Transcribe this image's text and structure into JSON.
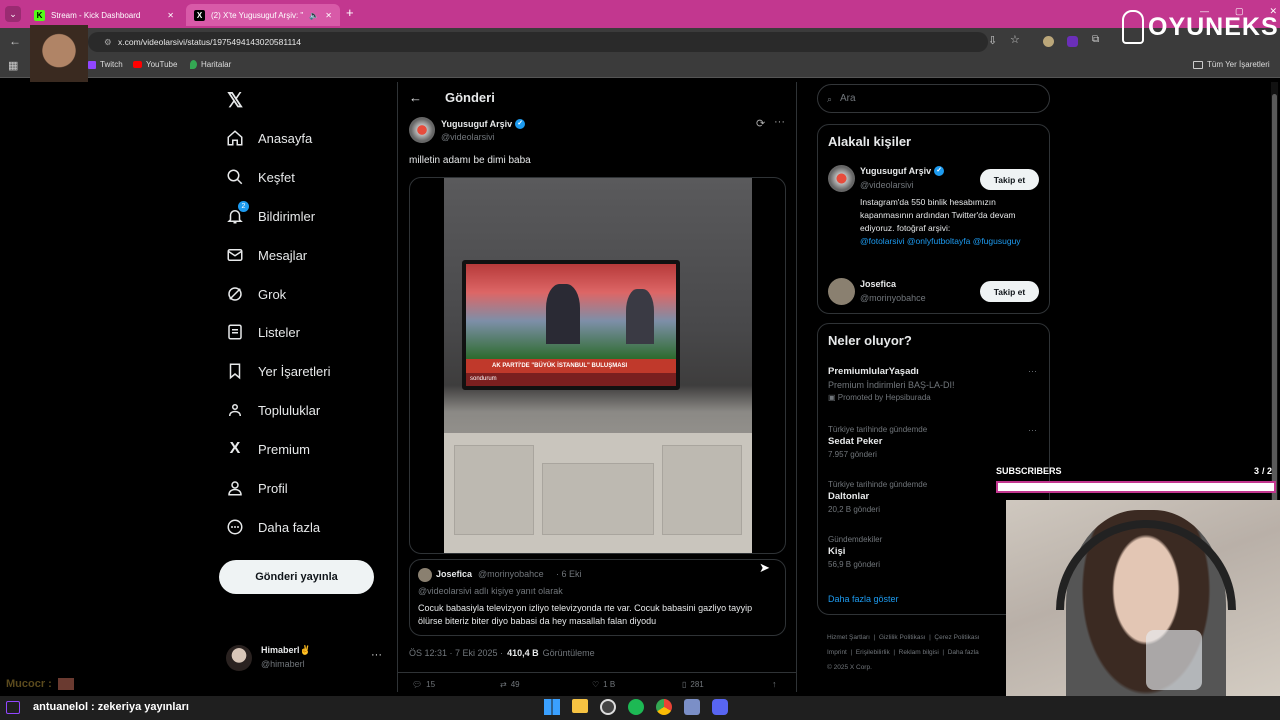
{
  "browser": {
    "tabs": [
      {
        "title": "Stream - Kick Dashboard"
      },
      {
        "title": "(2) X'te Yugusuguf Arşiv: \"m"
      }
    ],
    "url": "x.com/videolarsivi/status/1975494143020581114",
    "bookmarks": [
      "Twitch",
      "YouTube",
      "Haritalar"
    ],
    "bookmarks_right": "Tüm Yer İşaretleri",
    "brand_overlay": "OYUNEKS"
  },
  "nav": {
    "items": [
      "Anasayfa",
      "Keşfet",
      "Bildirimler",
      "Mesajlar",
      "Grok",
      "Listeler",
      "Yer İşaretleri",
      "Topluluklar",
      "Premium",
      "Profil",
      "Daha fazla"
    ],
    "notif_badge": "2",
    "post_button": "Gönderi yayınla",
    "account_name": "Himaberl✌",
    "account_handle": "@himaberl"
  },
  "post": {
    "header_title": "Gönderi",
    "author_name": "Yugusuguf Arşiv",
    "author_handle": "@videolarsivi",
    "text": "milletin adamı be dimi baba",
    "tv_caption": "AK PARTİ'DE \"BÜYÜK İSTANBUL\" BULUŞMASI",
    "tv_ticker": "sondurum",
    "quote_author": "Josefica",
    "quote_handle": "@morinyobahce",
    "quote_date": "· 6 Eki",
    "quote_reply_to": "@videolarsivi adlı kişiye yanıt olarak",
    "quote_text": "Cocuk babasiyla televizyon izliyo televizyonda rte var. Cocuk babasini gazliyo tayyip ölürse biteriz biter diyo babasi da hey masallah falan diyodu",
    "timestamp": "ÖS 12:31 · 7 Eki 2025 ·",
    "views_count": "410,4 B",
    "views_label": "Görüntüleme",
    "stats": [
      "15",
      "49",
      "1 B",
      "281"
    ]
  },
  "right": {
    "search_placeholder": "Ara",
    "relevant_title": "Alakalı kişiler",
    "people": [
      {
        "name": "Yugusuguf Arşiv",
        "handle": "@videolarsivi",
        "follow": "Takip et",
        "bio": "Instagram'da 550 binlik hesabımızın kapanmasının ardından Twitter'da devam ediyoruz. fotoğraf arşivi:",
        "bio_links": "@fotolarsivi @onlyfutboltayfa @fugusuguy"
      },
      {
        "name": "Josefica",
        "handle": "@morinyobahce",
        "follow": "Takip et"
      }
    ],
    "trends_title": "Neler oluyor?",
    "trends": [
      {
        "title": "PremiumlularYaşadı",
        "subtitle": "Premium İndirimleri BAŞ-LA-DI!",
        "meta": "Promoted by Hepsiburada"
      },
      {
        "context": "Türkiye tarihinde gündemde",
        "title": "Sedat Peker",
        "meta": "7.957 gönderi"
      },
      {
        "context": "Türkiye tarihinde gündemde",
        "title": "Daltonlar",
        "meta": "20,2 B gönderi"
      },
      {
        "context": "Gündemdekiler",
        "title": "Kişi",
        "meta": "56,9 B gönderi"
      }
    ],
    "show_more": "Daha fazla göster",
    "footer_links": [
      "Hizmet Şartları",
      "Gizlilik Politikası",
      "Çerez Politikası",
      "Imprint",
      "Erişilebilirlik",
      "Reklam bilgisi",
      "Daha fazla"
    ],
    "copyright": "© 2025 X Corp."
  },
  "overlays": {
    "subs_label": "SUBSCRIBERS",
    "subs_count": "3",
    "subs_goal": "/ 2",
    "subs_progress": 1.0,
    "chat_user1": "Mucocr :",
    "chat_line": "antuanelol : zekeriya yayınları"
  },
  "colors": {
    "tab_bar": "#c2378f",
    "accent": "#1d9bf0",
    "kick_green": "#53fc18"
  }
}
